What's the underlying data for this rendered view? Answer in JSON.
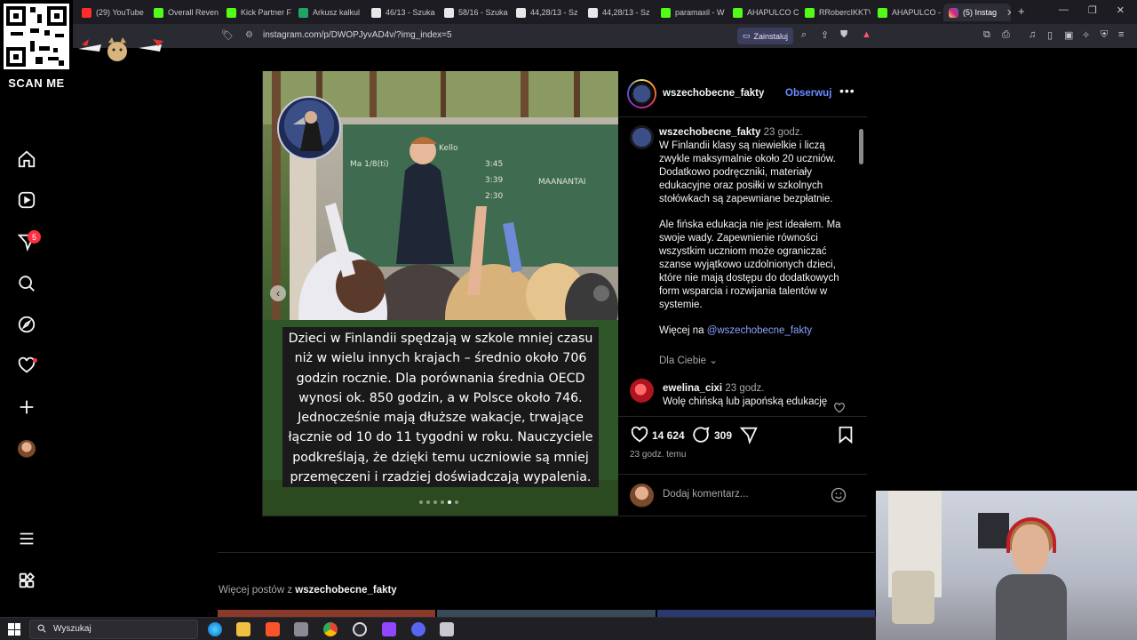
{
  "browser": {
    "tabs": [
      {
        "label": "(29) YouTube",
        "color": "#ff2d2d"
      },
      {
        "label": "Overall Reven",
        "color": "#53fc18"
      },
      {
        "label": "Kick Partner F",
        "color": "#53fc18"
      },
      {
        "label": "Arkusz kalkul",
        "color": "#21a464"
      },
      {
        "label": "46/13 - Szuka",
        "color": "#e8e8e8"
      },
      {
        "label": "58/16 - Szuka",
        "color": "#e8e8e8"
      },
      {
        "label": "44,28/13 - Sz",
        "color": "#e8e8e8"
      },
      {
        "label": "44,28/13 - Sz",
        "color": "#e8e8e8"
      },
      {
        "label": "paramaxil - W",
        "color": "#53fc18"
      },
      {
        "label": "AHAPULCO C",
        "color": "#53fc18"
      },
      {
        "label": "RRobercIKKTV",
        "color": "#53fc18"
      },
      {
        "label": "AHAPULCO -",
        "color": "#53fc18"
      }
    ],
    "active_tab": "(5) Instag",
    "url": "instagram.com/p/DWOPJyvAD4v/?img_index=5",
    "install_label": "Zainstaluj"
  },
  "overlay": {
    "qr_label": "SCAN ME"
  },
  "nav": {
    "icons": [
      "home-icon",
      "reels-icon",
      "messages-icon",
      "search-icon",
      "explore-icon",
      "notifications-icon",
      "create-icon",
      "profile-avatar",
      "more-menu-icon",
      "meta-apps-icon"
    ],
    "messages_badge": "5"
  },
  "post": {
    "image_caption": "Dzieci w Finlandii spędzają w szkole mniej czasu niż w wielu innych krajach – średnio około 706 godzin rocznie. Dla porównania średnia OECD wynosi ok. 850 godzin, a w Polsce około 746. Jednocześnie mają dłuższe wakacje, trwające łącznie od 10 do 11 tygodni w roku. Nauczyciele podkreślają, że dzięki temu uczniowie są mniej przemęczeni i rzadziej doświadczają wypalenia.",
    "carousel": {
      "count": 6,
      "current": 5
    }
  },
  "panel": {
    "username": "wszechobecne_fakty",
    "follow_label": "Obserwuj",
    "more_label": "•••",
    "caption": {
      "username": "wszechobecne_fakty",
      "time": "23 godz.",
      "p1": "W Finlandii klasy są niewielkie i liczą zwykle maksymalnie około 20 uczniów. Dodatkowo podręczniki, materiały edukacyjne oraz posiłki w szkolnych stołówkach są zapewniane bezpłatnie.",
      "p2": "Ale fińska edukacja nie jest ideałem. Ma swoje wady. Zapewnienie równości wszystkim uczniom może ograniczać szanse wyjątkowo uzdolnionych dzieci, które nie mają dostępu do dodatkowych form wsparcia i rozwijania talentów w systemie.",
      "more_prefix": "Więcej na",
      "more_link": "@wszechobecne_fakty"
    },
    "for_you": "Dla Ciebie",
    "comment": {
      "username": "ewelina_cixi",
      "time": "23 godz.",
      "text": "Wolę chińską lub japońską edukację"
    },
    "likes": "14 624",
    "comments_count": "309",
    "time_ago": "23 godz. temu",
    "add_comment_placeholder": "Dodaj komentarz..."
  },
  "more_posts": {
    "prefix": "Więcej postów z",
    "username": "wszechobecne_fakty"
  },
  "taskbar": {
    "search_label": "Wyszukaj"
  }
}
